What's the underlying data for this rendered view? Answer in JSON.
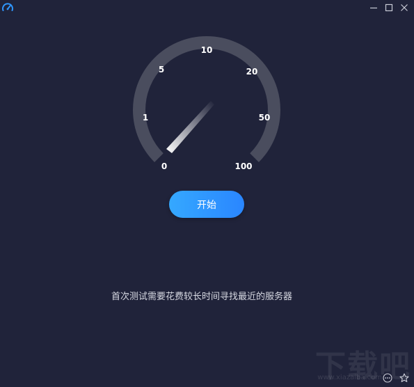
{
  "app": {
    "icon": "speedometer-icon"
  },
  "window_controls": {
    "minimize_icon": "minimize-icon",
    "maximize_icon": "maximize-icon",
    "close_icon": "close-icon"
  },
  "gauge": {
    "ticks": [
      "0",
      "1",
      "5",
      "10",
      "20",
      "50",
      "100"
    ],
    "track_color": "#4a4d5e",
    "current_value": 0
  },
  "start_button": {
    "label": "开始",
    "color": "#2f97ff"
  },
  "hint": {
    "text": "首次测试需要花费较长时间寻找最近的服务器"
  },
  "watermark": {
    "logo": "下载吧",
    "url": "www.xiazaiba.com"
  },
  "footer_icons": {
    "more_icon": "more-icon",
    "favorite_icon": "star-icon"
  },
  "colors": {
    "background": "#20233a",
    "accent": "#2f97ff"
  }
}
